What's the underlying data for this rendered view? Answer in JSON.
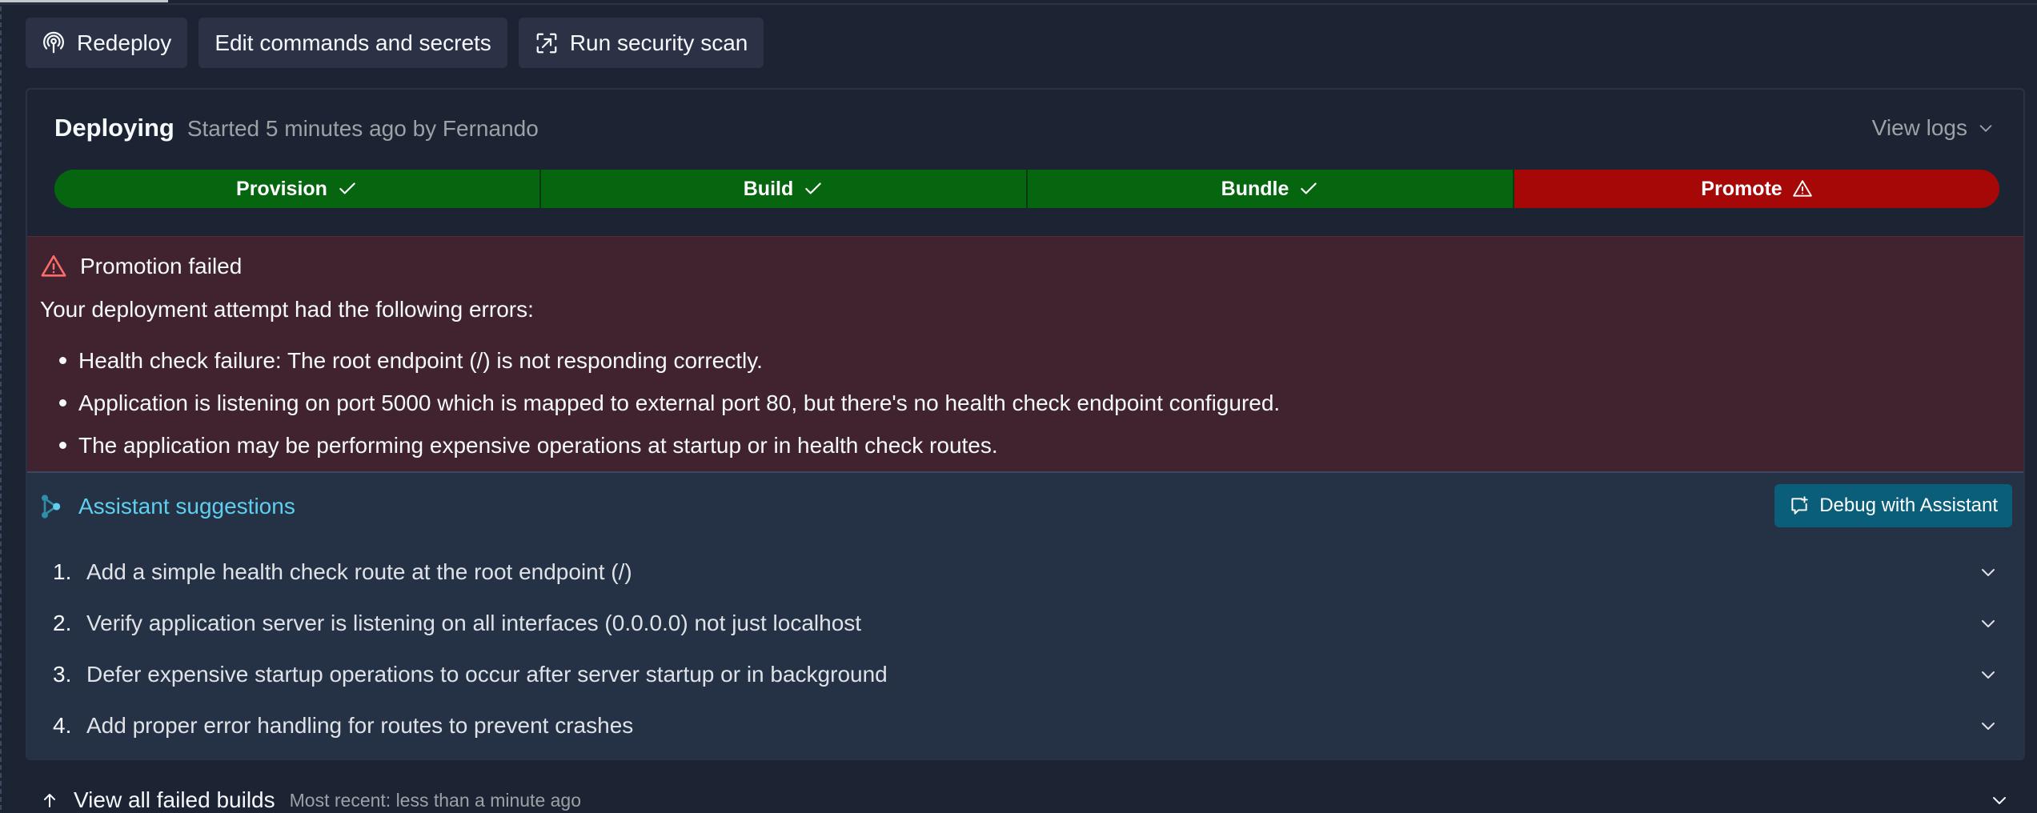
{
  "toolbar": {
    "redeploy_label": "Redeploy",
    "edit_label": "Edit commands and secrets",
    "scan_label": "Run security scan"
  },
  "deployment": {
    "status": "Deploying",
    "meta": "Started 5 minutes ago by Fernando",
    "view_logs_label": "View logs",
    "steps": [
      {
        "label": "Provision",
        "state": "success"
      },
      {
        "label": "Build",
        "state": "success"
      },
      {
        "label": "Bundle",
        "state": "success"
      },
      {
        "label": "Promote",
        "state": "failed"
      }
    ]
  },
  "error": {
    "title": "Promotion failed",
    "intro": "Your deployment attempt had the following errors:",
    "items": [
      "Health check failure: The root endpoint (/) is not responding correctly.",
      "Application is listening on port 5000 which is mapped to external port 80, but there's no health check endpoint configured.",
      "The application may be performing expensive operations at startup or in health check routes."
    ]
  },
  "assistant": {
    "title": "Assistant suggestions",
    "debug_button_label": "Debug with Assistant",
    "suggestions": [
      {
        "num": "1.",
        "text": "Add a simple health check route at the root endpoint (/)"
      },
      {
        "num": "2.",
        "text": "Verify application server is listening on all interfaces (0.0.0.0) not just localhost"
      },
      {
        "num": "3.",
        "text": "Defer expensive startup operations to occur after server startup or in background"
      },
      {
        "num": "4.",
        "text": "Add proper error handling for routes to prevent crashes"
      }
    ]
  },
  "failed_builds": {
    "title": "View all failed builds",
    "subtitle": "Most recent: less than a minute ago"
  },
  "colors": {
    "background": "#1c2333",
    "step_success": "#06660f",
    "step_failed": "#a60808",
    "error_panel": "#40232e",
    "assistant_panel": "#253144",
    "assistant_accent": "#5fcfef",
    "debug_button": "#0b5e7a"
  }
}
